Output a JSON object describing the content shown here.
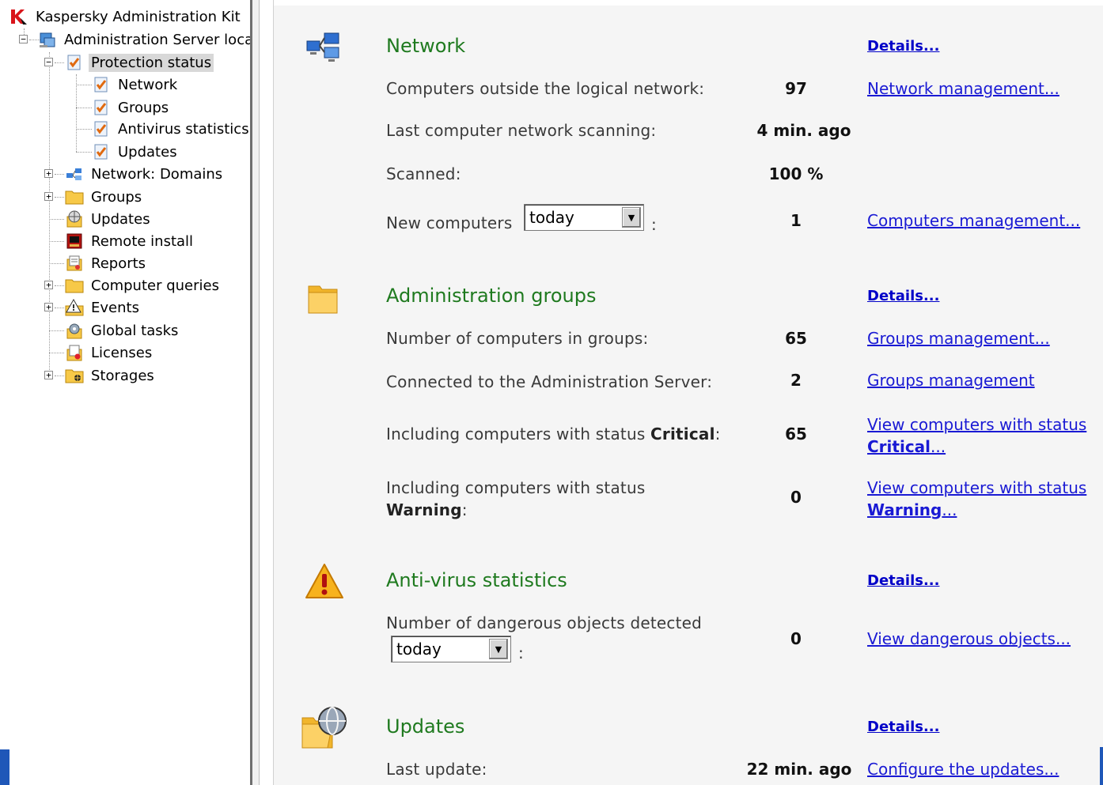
{
  "tree": {
    "root": "Kaspersky Administration Kit",
    "server": "Administration Server localh",
    "protection_status": "Protection status",
    "ps_children": [
      "Network",
      "Groups",
      "Antivirus statistics",
      "Updates"
    ],
    "items": [
      "Network: Domains",
      "Groups",
      "Updates",
      "Remote install",
      "Reports",
      "Computer queries",
      "Events",
      "Global tasks",
      "Licenses",
      "Storages"
    ]
  },
  "network": {
    "title": "Network",
    "details": "Details...",
    "outside_label": "Computers outside the logical network:",
    "outside_value": "97",
    "net_mgmt_link": "Network management...",
    "scan_label": "Last computer network scanning:",
    "scan_value": "4 min. ago",
    "scanned_label": "Scanned:",
    "scanned_value": "100 %",
    "new_label": "New computers",
    "new_select": "today",
    "colon": ":",
    "new_value": "1",
    "comp_mgmt_link": "Computers management..."
  },
  "groups": {
    "title": "Administration groups",
    "details": "Details...",
    "in_groups_label": "Number of computers in groups:",
    "in_groups_value": "65",
    "groups_mgmt_link": "Groups management...",
    "connected_label": "Connected to the Administration Server:",
    "connected_value": "2",
    "groups_mgmt_link2": "Groups management",
    "critical_label_pre": "Including computers with status ",
    "critical_label_bold": "Critical",
    "critical_label_post": ":",
    "critical_value": "65",
    "critical_link_pre": "View computers with status",
    "critical_link_bold": "Critical",
    "critical_link_post": "...",
    "warning_label_pre": "Including computers with status",
    "warning_label_bold": "Warning",
    "warning_label_post": ":",
    "warning_value": "0",
    "warning_link_pre": "View computers with status",
    "warning_link_bold": "Warning",
    "warning_link_post": "..."
  },
  "antivirus": {
    "title": "Anti-virus statistics",
    "details": "Details...",
    "dangerous_label": "Number of dangerous objects detected",
    "dangerous_select": "today",
    "colon": ":",
    "dangerous_value": "0",
    "view_link": "View dangerous objects..."
  },
  "updates": {
    "title": "Updates",
    "details": "Details...",
    "last_label": "Last update:",
    "last_value": "22 min. ago",
    "configure_link": "Configure the updates..."
  },
  "colors": {
    "section_title": "#1f7a1f",
    "link": "#1a1ad4",
    "selected_bg": "#d8d8d8",
    "pane_bg": "#f5f5f5",
    "accent_blue": "#1f57b8"
  }
}
